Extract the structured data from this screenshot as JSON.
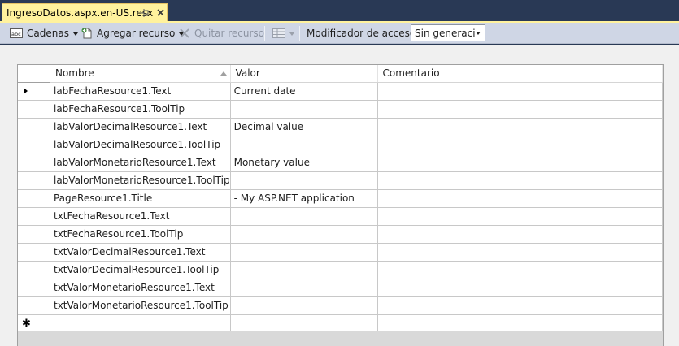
{
  "document_tab": {
    "title": "IngresoDatos.aspx.en-US.resx"
  },
  "toolbar": {
    "strings_label": "Cadenas",
    "add_resource_label": "Agregar recurso",
    "remove_resource_label": "Quitar recurso",
    "access_modifier_label": "Modificador de acceso:",
    "access_modifier_value": "Sin generació"
  },
  "grid": {
    "columns": {
      "name": "Nombre",
      "value": "Valor",
      "comment": "Comentario"
    },
    "rows": [
      {
        "name": "labFechaResource1.Text",
        "value": "Current date",
        "comment": ""
      },
      {
        "name": "labFechaResource1.ToolTip",
        "value": "",
        "comment": ""
      },
      {
        "name": "labValorDecimalResource1.Text",
        "value": "Decimal value",
        "comment": ""
      },
      {
        "name": "labValorDecimalResource1.ToolTip",
        "value": "",
        "comment": ""
      },
      {
        "name": "labValorMonetarioResource1.Text",
        "value": "Monetary value",
        "comment": ""
      },
      {
        "name": "labValorMonetarioResource1.ToolTip",
        "value": "",
        "comment": ""
      },
      {
        "name": "PageResource1.Title",
        "value": "- My ASP.NET application",
        "comment": ""
      },
      {
        "name": "txtFechaResource1.Text",
        "value": "",
        "comment": ""
      },
      {
        "name": "txtFechaResource1.ToolTip",
        "value": "",
        "comment": ""
      },
      {
        "name": "txtValorDecimalResource1.Text",
        "value": "",
        "comment": ""
      },
      {
        "name": "txtValorDecimalResource1.ToolTip",
        "value": "",
        "comment": ""
      },
      {
        "name": "txtValorMonetarioResource1.Text",
        "value": "",
        "comment": ""
      },
      {
        "name": "txtValorMonetarioResource1.ToolTip",
        "value": "",
        "comment": ""
      }
    ],
    "new_row_symbol": "✱"
  },
  "colors": {
    "chrome": "#293955",
    "active_tab": "#fff29d",
    "toolbar": "#cfd6e5"
  }
}
